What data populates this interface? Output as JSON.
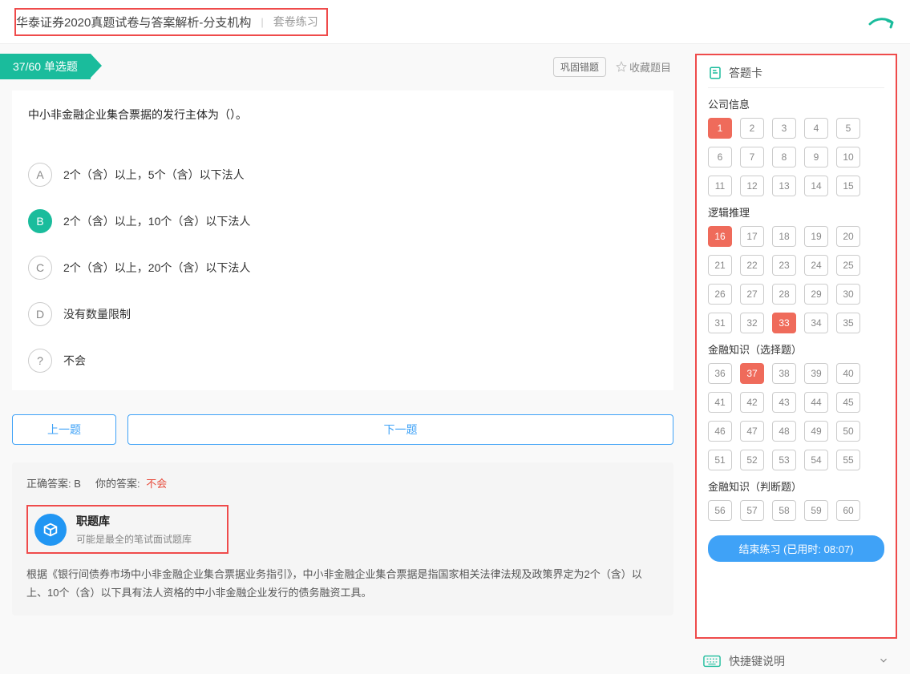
{
  "header": {
    "title": "华泰证券2020真题试卷与答案解析-分支机构",
    "mode_label": "套卷练习"
  },
  "question_index": {
    "current": 37,
    "total": 60,
    "type": "单选题",
    "display": "37/60 单选题"
  },
  "actions": {
    "consolidate": "巩固错题",
    "favorite": "收藏题目"
  },
  "question": {
    "text": "中小非金融企业集合票据的发行主体为（）。",
    "choices": [
      {
        "letter": "A",
        "text": "2个（含）以上，5个（含）以下法人"
      },
      {
        "letter": "B",
        "text": "2个（含）以上，10个（含）以下法人"
      },
      {
        "letter": "C",
        "text": "2个（含）以上，20个（含）以下法人"
      },
      {
        "letter": "D",
        "text": "没有数量限制"
      },
      {
        "letter": "?",
        "text": "不会"
      }
    ],
    "selected_index": 1
  },
  "nav": {
    "prev": "上一题",
    "next": "下一题"
  },
  "answer": {
    "correct_label": "正确答案:",
    "correct_value": "B",
    "your_label": "你的答案:",
    "your_value": "不会",
    "brand_title": "职题库",
    "brand_sub": "可能是最全的笔试面试题库",
    "explanation": "根据《银行间债券市场中小非金融企业集合票据业务指引》，中小非金融企业集合票据是指国家相关法律法规及政策界定为2个（含）以上、10个（含）以下具有法人资格的中小非金融企业发行的债务融资工具。"
  },
  "sidebar": {
    "title": "答题卡",
    "sections": [
      {
        "title": "公司信息",
        "start": 1,
        "end": 15,
        "active": [
          1
        ]
      },
      {
        "title": "逻辑推理",
        "start": 16,
        "end": 35,
        "active": [
          16,
          33
        ]
      },
      {
        "title": "金融知识（选择题）",
        "start": 36,
        "end": 55,
        "active": [
          37
        ]
      },
      {
        "title": "金融知识（判断题）",
        "start": 56,
        "end": 60,
        "active": []
      }
    ],
    "finish_prefix": "结束练习 (已用时: ",
    "finish_time": "08:07",
    "finish_suffix": ")"
  },
  "shortcut": {
    "label": "快捷键说明"
  }
}
